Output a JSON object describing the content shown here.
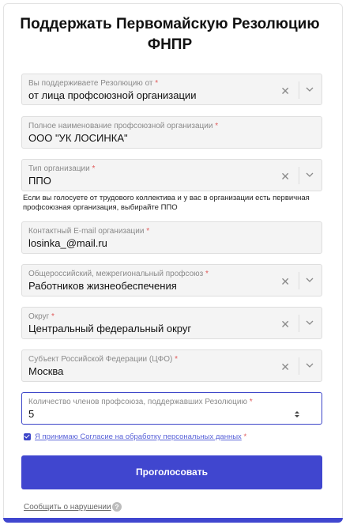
{
  "title": "Поддержать Первомайскую Резолюцию ФНПР",
  "required_mark": "*",
  "fields": [
    {
      "label": "Вы поддерживаете Резолюцию от",
      "value": "от лица профсоюзной организации"
    },
    {
      "label": "Полное наименование профсоюзной организации",
      "value": "ООО \"УК ЛОСИНКА\""
    },
    {
      "label": "Тип организации",
      "value": "ППО"
    },
    {
      "label": "Контактный E-mail организации",
      "value": "losinka_@mail.ru"
    },
    {
      "label": "Общероссийский, межрегиональный профсоюз",
      "value": "Работников жизнеобеспечения"
    },
    {
      "label": "Округ",
      "value": "Центральный федеральный округ"
    },
    {
      "label": "Субъект Российской Федерации (ЦФО)",
      "value": "Москва"
    },
    {
      "label": "Количество членов профсоюза, поддержавших Резолюцию",
      "value": "5"
    }
  ],
  "hint": "Если вы голосуете от трудового коллектива и у вас в организации есть первичная профсоюзная организация, выбирайте ППО",
  "consent": {
    "text": "Я принимаю Согласие на обработку персональных данных",
    "checked": true
  },
  "submit_label": "Проголосовать",
  "report_link": "Сообщить о нарушении",
  "help_icon_glyph": "?",
  "clear_icon_glyph": "✕",
  "colors": {
    "accent": "#4046cf",
    "required": "#e05a5a"
  }
}
